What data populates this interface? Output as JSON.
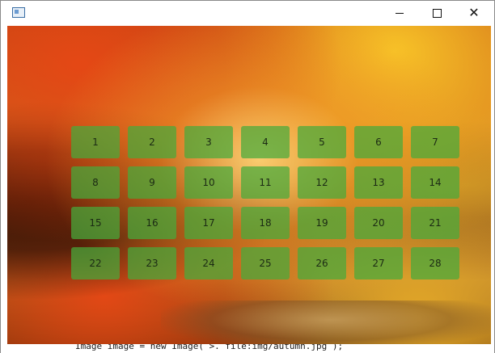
{
  "window": {
    "title": "",
    "icon": "app-window-icon",
    "controls": {
      "minimize": "minimize-icon",
      "maximize": "maximize-icon",
      "close": "close-icon",
      "close_glyph": "✕"
    }
  },
  "background": {
    "description_icon": "autumn-maple-photo"
  },
  "grid": {
    "columns": 7,
    "cells": [
      "1",
      "2",
      "3",
      "4",
      "5",
      "6",
      "7",
      "8",
      "9",
      "10",
      "11",
      "12",
      "13",
      "14",
      "15",
      "16",
      "17",
      "18",
      "19",
      "20",
      "21",
      "22",
      "23",
      "24",
      "25",
      "26",
      "27",
      "28"
    ],
    "cell_color": "#46aa3c"
  },
  "code_snippet": {
    "text": "Image image = new Image( >. file:img/autumn.jpg );"
  }
}
